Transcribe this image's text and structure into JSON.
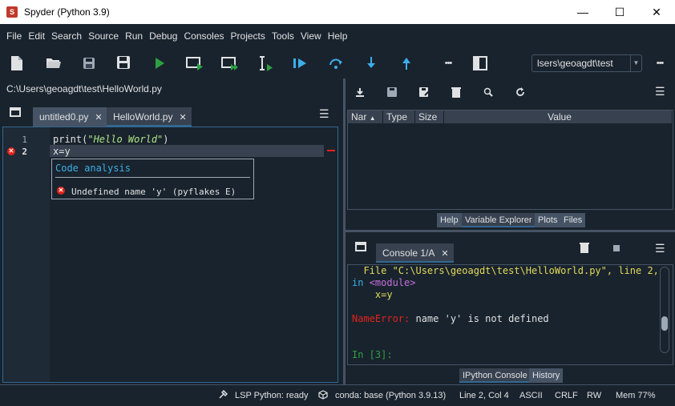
{
  "window": {
    "title": "Spyder (Python 3.9)",
    "minimize": "—",
    "maximize": "☐",
    "close": "✕"
  },
  "menu": [
    "File",
    "Edit",
    "Search",
    "Source",
    "Run",
    "Debug",
    "Consoles",
    "Projects",
    "Tools",
    "View",
    "Help"
  ],
  "toolbar": {
    "working_dir": "lsers\\geoagdt\\test",
    "more1": "•••",
    "more2": "•••"
  },
  "editor": {
    "path": "C:\\Users\\geoagdt\\test\\HelloWorld.py",
    "tabs": [
      {
        "label": "untitled0.py",
        "close": "✕"
      },
      {
        "label": "HelloWorld.py",
        "close": "✕"
      }
    ],
    "lines": [
      {
        "no": "1",
        "func": "print",
        "open": "(",
        "str": "\"Hello World\"",
        "close": ")"
      },
      {
        "no": "2",
        "text": "x=y"
      }
    ],
    "tooltip": {
      "header": "Code analysis",
      "message": "Undefined name 'y' (pyflakes E)"
    }
  },
  "variable_explorer": {
    "columns": [
      "Nar",
      "Type",
      "Size",
      "Value"
    ],
    "tabs": [
      "Help",
      "Variable Explorer",
      "Plots",
      "Files"
    ]
  },
  "console": {
    "tab": {
      "label": "Console 1/A",
      "close": "✕"
    },
    "line1": "  File \"C:\\Users\\geoagdt\\test\\HelloWorld.py\", line 2,",
    "line2_in": "in ",
    "line2_mod": "<module>",
    "line3": "    x=y",
    "error_name": "NameError:",
    "error_msg": " name 'y' is not defined",
    "prompt": "In [3]:",
    "tabs": [
      "IPython Console",
      "History"
    ]
  },
  "status": {
    "lsp": "LSP Python: ready",
    "conda": "conda: base (Python 3.9.13)",
    "position": "Line 2, Col 4",
    "encoding": "ASCII",
    "eol": "CRLF",
    "rw": "RW",
    "mem": "Mem 77%"
  },
  "colors": {
    "background": "#19232d",
    "accent": "#3daee9",
    "error": "#e2231a",
    "string": "#b0e686",
    "keyword": "#c670e0"
  }
}
